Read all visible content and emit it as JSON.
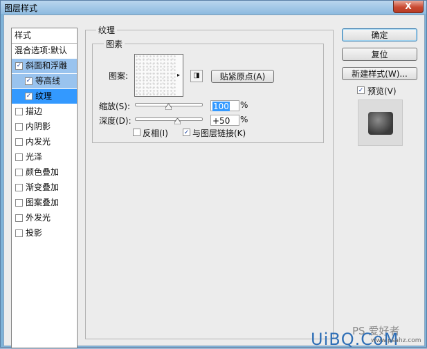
{
  "window": {
    "title": "图层样式",
    "close_label": "X"
  },
  "style_list": {
    "header": "样式",
    "blend": "混合选项:默认",
    "items": [
      {
        "label": "斜面和浮雕",
        "checked": true
      },
      {
        "label": "等高线",
        "checked": true
      },
      {
        "label": "纹理",
        "checked": true
      },
      {
        "label": "描边",
        "checked": false
      },
      {
        "label": "内阴影",
        "checked": false
      },
      {
        "label": "内发光",
        "checked": false
      },
      {
        "label": "光泽",
        "checked": false
      },
      {
        "label": "颜色叠加",
        "checked": false
      },
      {
        "label": "渐变叠加",
        "checked": false
      },
      {
        "label": "图案叠加",
        "checked": false
      },
      {
        "label": "外发光",
        "checked": false
      },
      {
        "label": "投影",
        "checked": false
      }
    ]
  },
  "texture": {
    "group_title": "纹理",
    "subgroup_title": "图素",
    "pattern_label": "图案:",
    "snap_button": "贴紧原点(A)",
    "scale_label": "缩放(S):",
    "scale_value": "100",
    "scale_unit": "%",
    "depth_label": "深度(D):",
    "depth_value": "+50",
    "depth_unit": "%",
    "invert_label": "反相(I)",
    "invert_checked": false,
    "link_label": "与图层链接(K)",
    "link_checked": true
  },
  "buttons": {
    "ok": "确定",
    "reset": "复位",
    "new_style": "新建样式(W)...",
    "preview_label": "预览(V)",
    "preview_checked": true
  },
  "watermark": {
    "text": "UiBQ.CoM",
    "ps": "PS 爱好者",
    "small": "www.psahz.com"
  },
  "icons": {
    "check": "✓",
    "dropdown": "▸",
    "new": "◨"
  }
}
